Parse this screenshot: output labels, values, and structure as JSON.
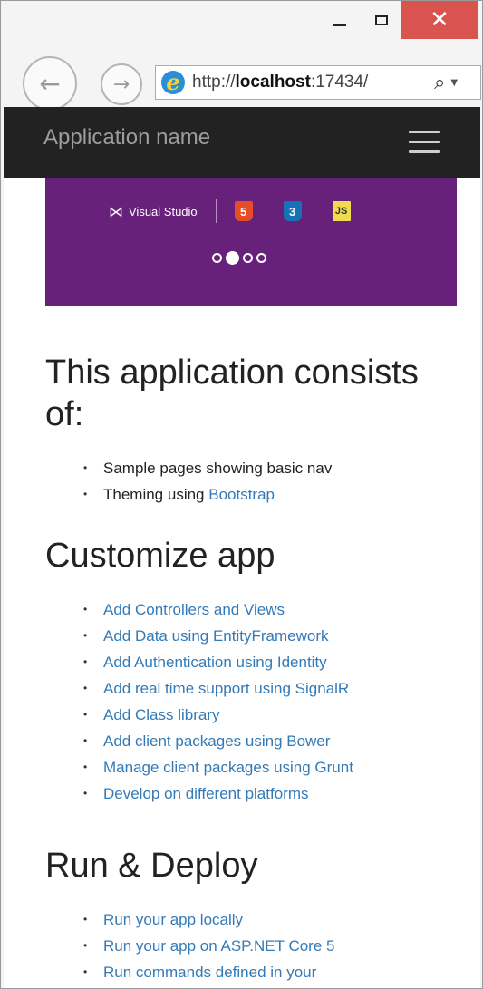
{
  "browser": {
    "close_glyph": "✕",
    "back_glyph": "←",
    "forward_glyph": "→",
    "ie_glyph": "e",
    "url_prefix": "http://",
    "url_host": "localhost",
    "url_rest": ":17434/",
    "search_glyph": "⌕",
    "dropdown_glyph": "▼"
  },
  "site": {
    "brand": "Application name"
  },
  "carousel": {
    "vs_icon": "⋈",
    "vs_label": "Visual Studio",
    "tech_html": "5",
    "tech_css": "3",
    "tech_js": "JS",
    "slide_count": 4,
    "active_slide": 2
  },
  "sections": {
    "app": {
      "heading": "This application consists of:",
      "items": [
        {
          "text": "Sample pages showing basic nav",
          "link": ""
        },
        {
          "text": "Theming using ",
          "link": "Bootstrap"
        }
      ]
    },
    "customize": {
      "heading": "Customize app",
      "items": [
        "Add Controllers and Views",
        "Add Data using EntityFramework",
        "Add Authentication using Identity",
        "Add real time support using SignalR",
        "Add Class library",
        "Add client packages using Bower",
        "Manage client packages using Grunt",
        "Develop on different platforms"
      ]
    },
    "run": {
      "heading": "Run & Deploy",
      "items": [
        "Run your app locally",
        "Run your app on ASP.NET Core 5",
        "Run commands defined in your"
      ]
    }
  },
  "colors": {
    "navbar": "#222222",
    "carousel": "#68217a",
    "link": "#337ab7",
    "close_button": "#d9534f"
  }
}
